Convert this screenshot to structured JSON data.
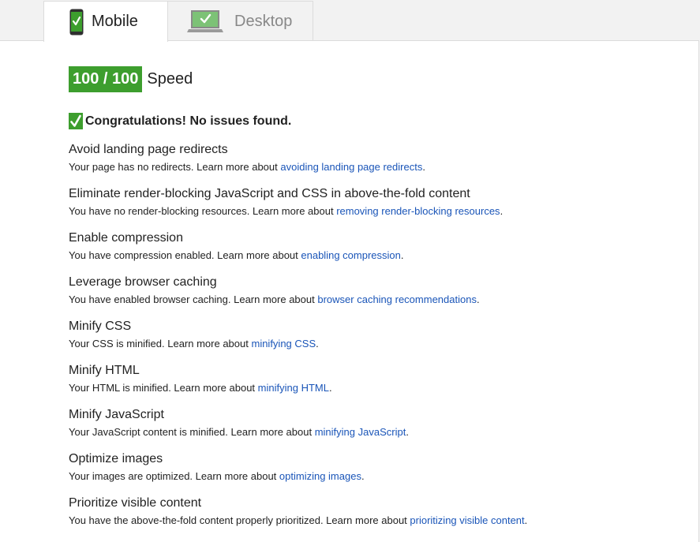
{
  "tabs": [
    {
      "label": "Mobile",
      "icon": "mobile-phone-icon",
      "active": true
    },
    {
      "label": "Desktop",
      "icon": "desktop-computer-icon",
      "active": false
    }
  ],
  "score": {
    "value": "100 / 100",
    "label": "Speed",
    "color": "#3d9e2e"
  },
  "congrats": "Congratulations! No issues found.",
  "rules": [
    {
      "title": "Avoid landing page redirects",
      "desc": "Your page has no redirects. Learn more about ",
      "link": "avoiding landing page redirects",
      "end": "."
    },
    {
      "title": "Eliminate render-blocking JavaScript and CSS in above-the-fold content",
      "desc": "You have no render-blocking resources. Learn more about ",
      "link": "removing render-blocking resources",
      "end": "."
    },
    {
      "title": "Enable compression",
      "desc": "You have compression enabled. Learn more about ",
      "link": "enabling compression",
      "end": "."
    },
    {
      "title": "Leverage browser caching",
      "desc": "You have enabled browser caching. Learn more about ",
      "link": "browser caching recommendations",
      "end": "."
    },
    {
      "title": "Minify CSS",
      "desc": "Your CSS is minified. Learn more about ",
      "link": "minifying CSS",
      "end": "."
    },
    {
      "title": "Minify HTML",
      "desc": "Your HTML is minified. Learn more about ",
      "link": "minifying HTML",
      "end": "."
    },
    {
      "title": "Minify JavaScript",
      "desc": "Your JavaScript content is minified. Learn more about ",
      "link": "minifying JavaScript",
      "end": "."
    },
    {
      "title": "Optimize images",
      "desc": "Your images are optimized. Learn more about ",
      "link": "optimizing images",
      "end": "."
    },
    {
      "title": "Prioritize visible content",
      "desc": "You have the above-the-fold content properly prioritized. Learn more about ",
      "link": "prioritizing visible content",
      "end": "."
    }
  ],
  "colors": {
    "accent_green": "#3d9e2e",
    "link_blue": "#1a55b8"
  }
}
